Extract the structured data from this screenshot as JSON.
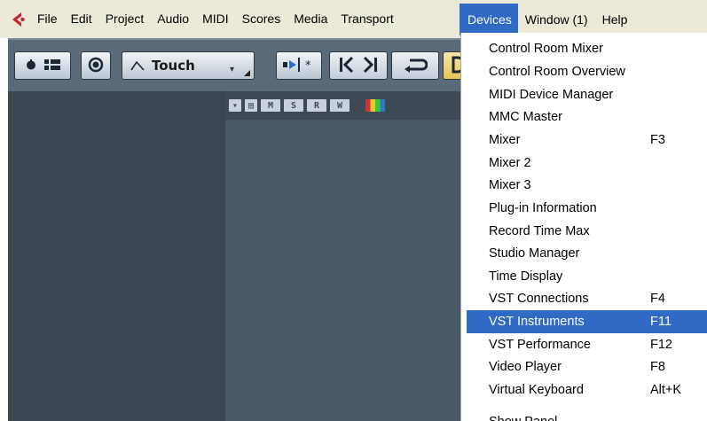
{
  "menubar": {
    "items": [
      "File",
      "Edit",
      "Project",
      "Audio",
      "MIDI",
      "Scores",
      "Media",
      "Transport"
    ],
    "right_items": [
      "Devices",
      "Window (1)",
      "Help"
    ],
    "active": "Devices",
    "active_color": "#316ac5"
  },
  "toolbar": {
    "automation_mode": "Touch"
  },
  "track_header": {
    "buttons": [
      "M",
      "S",
      "R",
      "W"
    ]
  },
  "devices_menu": {
    "items": [
      {
        "label": "Control Room Mixer",
        "shortcut": ""
      },
      {
        "label": "Control Room Overview",
        "shortcut": ""
      },
      {
        "label": "MIDI Device Manager",
        "shortcut": ""
      },
      {
        "label": "MMC Master",
        "shortcut": ""
      },
      {
        "label": "Mixer",
        "shortcut": "F3"
      },
      {
        "label": "Mixer 2",
        "shortcut": ""
      },
      {
        "label": "Mixer 3",
        "shortcut": ""
      },
      {
        "label": "Plug-in Information",
        "shortcut": ""
      },
      {
        "label": "Record Time Max",
        "shortcut": ""
      },
      {
        "label": "Studio Manager",
        "shortcut": ""
      },
      {
        "label": "Time Display",
        "shortcut": ""
      },
      {
        "label": "VST Connections",
        "shortcut": "F4"
      },
      {
        "label": "VST Instruments",
        "shortcut": "F11"
      },
      {
        "label": "VST Performance",
        "shortcut": "F12"
      },
      {
        "label": "Video Player",
        "shortcut": "F8"
      },
      {
        "label": "Virtual Keyboard",
        "shortcut": "Alt+K"
      },
      {
        "label": "Show Panel",
        "shortcut": ""
      }
    ],
    "selected": "VST Instruments"
  },
  "icons": {
    "logo": "cubase-logo-icon",
    "power": "power-icon",
    "list": "list-icon",
    "constrain": "constrain-delay-icon",
    "automation": "automation-icon",
    "snap": "snap-icon",
    "prev": "go-to-previous-marker-icon",
    "next": "go-to-next-marker-icon",
    "cycle": "cycle-icon"
  }
}
